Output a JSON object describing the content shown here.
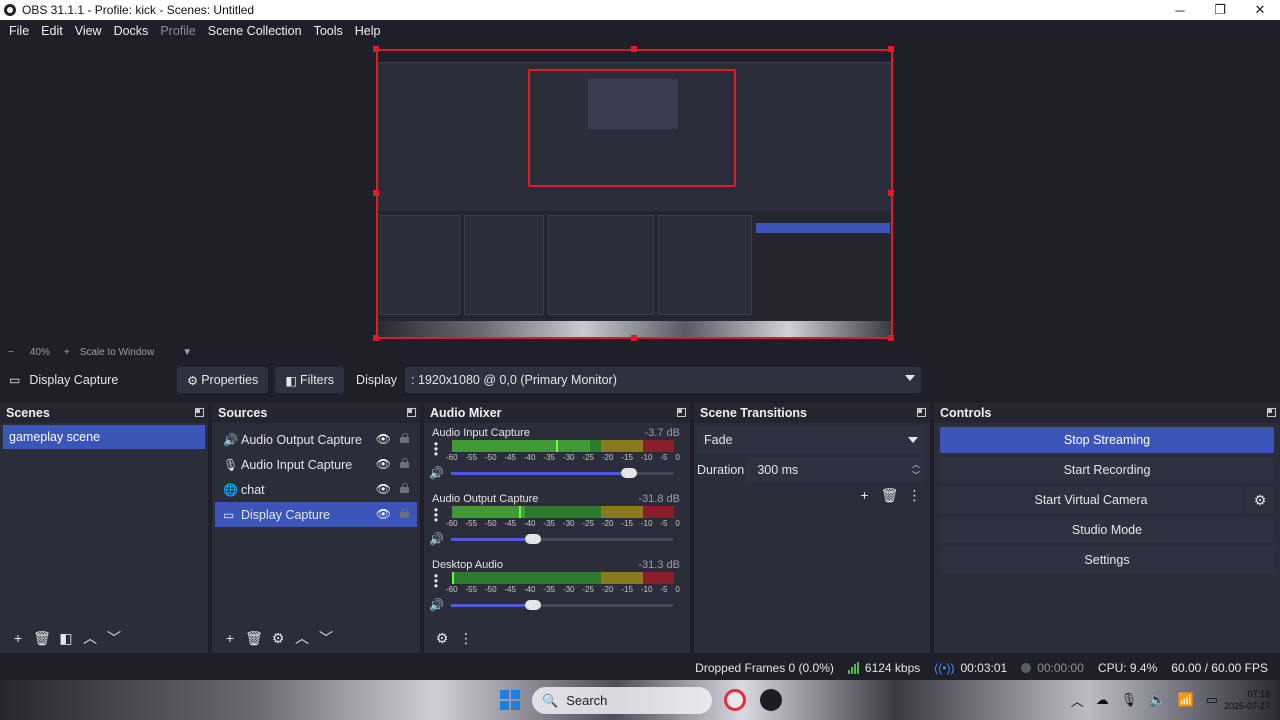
{
  "window": {
    "title": "OBS 31.1.1 - Profile: kick - Scenes: Untitled",
    "controls": [
      "─",
      "❐",
      "✕"
    ]
  },
  "menu": [
    {
      "label": "File",
      "enabled": true
    },
    {
      "label": "Edit",
      "enabled": true
    },
    {
      "label": "View",
      "enabled": true
    },
    {
      "label": "Docks",
      "enabled": true
    },
    {
      "label": "Profile",
      "enabled": false
    },
    {
      "label": "Scene Collection",
      "enabled": true
    },
    {
      "label": "Tools",
      "enabled": true
    },
    {
      "label": "Help",
      "enabled": true
    }
  ],
  "zoom": {
    "minus": "−",
    "value": "40%",
    "plus": "+",
    "mode": "Scale to Window"
  },
  "source_toolbar": {
    "source_name": "Display Capture",
    "properties_label": "Properties",
    "filters_label": "Filters",
    "display_label": "Display",
    "display_value": ": 1920x1080 @ 0,0 (Primary Monitor)"
  },
  "scenes": {
    "title": "Scenes",
    "items": [
      "gameplay scene"
    ]
  },
  "sources": {
    "title": "Sources",
    "items": [
      {
        "label": "Audio Output Capture",
        "icon": "speaker-icon",
        "selected": false
      },
      {
        "label": "Audio Input Capture",
        "icon": "microphone-icon",
        "selected": false
      },
      {
        "label": "chat",
        "icon": "globe-icon",
        "selected": false
      },
      {
        "label": "Display Capture",
        "icon": "monitor-icon",
        "selected": true
      }
    ]
  },
  "mixer": {
    "title": "Audio Mixer",
    "scale": [
      "-60",
      "-55",
      "-50",
      "-45",
      "-40",
      "-35",
      "-30",
      "-25",
      "-20",
      "-15",
      "-10",
      "-5",
      "0"
    ],
    "channels": [
      {
        "name": "Audio Input Capture",
        "db": "-3.7 dB",
        "level": 0.62,
        "peak": 0.47,
        "volume": 0.8
      },
      {
        "name": "Audio Output Capture",
        "db": "-31.8 dB",
        "level": 0.33,
        "peak": 0.3,
        "volume": 0.37
      },
      {
        "name": "Desktop Audio",
        "db": "-31.3 dB",
        "level": 0.0,
        "peak": 0.0,
        "volume": 0.37
      }
    ]
  },
  "transitions": {
    "title": "Scene Transitions",
    "selected": "Fade",
    "duration_label": "Duration",
    "duration_value": "300 ms"
  },
  "controls": {
    "title": "Controls",
    "stop_streaming": "Stop Streaming",
    "start_recording": "Start Recording",
    "start_virtual_camera": "Start Virtual Camera",
    "studio_mode": "Studio Mode",
    "settings": "Settings"
  },
  "status": {
    "dropped_frames": "Dropped Frames 0 (0.0%)",
    "bitrate": "6124 kbps",
    "stream_time": "00:03:01",
    "rec_time": "00:00:00",
    "cpu": "CPU: 9.4%",
    "fps": "60.00 / 60.00 FPS"
  },
  "taskbar": {
    "search_placeholder": "Search",
    "time": "07:18",
    "date": "2025-07-27"
  },
  "colors": {
    "accent": "#3b55b8",
    "background": "#1e1f29",
    "panel": "#2b2d3a",
    "selection_border": "#e01b24"
  }
}
